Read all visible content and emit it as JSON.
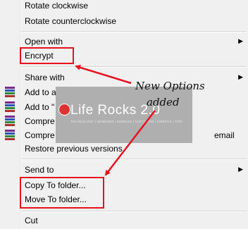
{
  "menu": {
    "items": [
      {
        "label": "Rotate clockwise"
      },
      {
        "label": "Rotate counterclockwise"
      },
      {
        "label": "Open with",
        "submenu": true
      },
      {
        "label": "Encrypt"
      },
      {
        "label": "Share with",
        "submenu": true
      },
      {
        "label": "Add to a"
      },
      {
        "label": "Add to \""
      },
      {
        "label": "Compre"
      },
      {
        "label": "Compre",
        "suffix": "email"
      },
      {
        "label": "Restore previous versions"
      },
      {
        "label": "Send to",
        "submenu": true
      },
      {
        "label": "Copy To folder..."
      },
      {
        "label": "Move To folder..."
      },
      {
        "label": "Cut"
      }
    ]
  },
  "icons": {
    "submenu_arrow": "▶",
    "archive": "winrar-archive-icon"
  },
  "annotation": {
    "line1": "New Options",
    "line2": "added"
  },
  "watermark": {
    "title": "Life Rocks 2.0",
    "subtitle": "TECHNOLOGY | WINDOWS | MOBILES | SOFTWARE | FIREFOX | TIPS"
  },
  "colors": {
    "highlight": "#e8121f",
    "menu_bg": "#f0f0f0"
  }
}
